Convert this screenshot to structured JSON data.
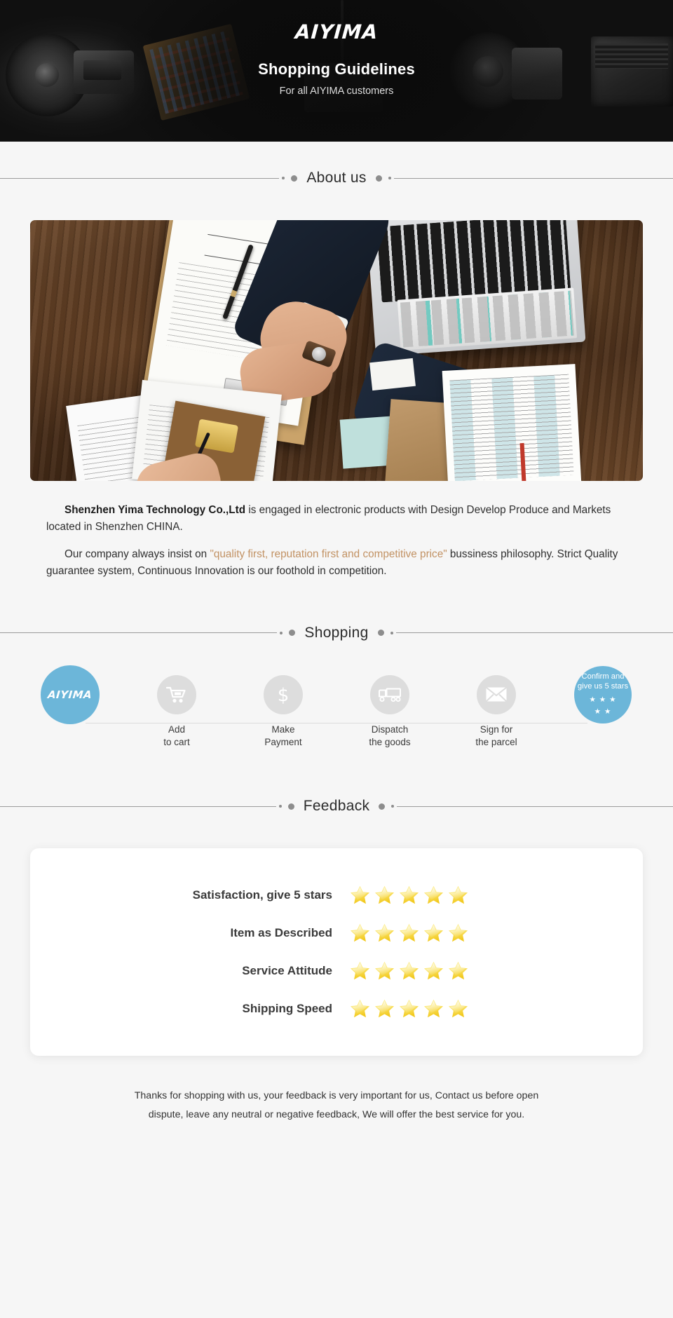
{
  "hero": {
    "brand": "AIYIMA",
    "title": "Shopping Guidelines",
    "subtitle": "For all AIYIMA customers",
    "background_color": "#111111"
  },
  "sections": {
    "about": {
      "divider_label": "About us"
    },
    "shopping": {
      "divider_label": "Shopping"
    },
    "feedback": {
      "divider_label": "Feedback"
    }
  },
  "about": {
    "paragraph1": {
      "strong": "Shenzhen Yima Technology Co.,Ltd",
      "rest": " is engaged in electronic products with Design Develop Produce and Markets located in Shenzhen CHINA."
    },
    "paragraph2": {
      "lead": "Our company always insist on ",
      "quote": "\"quality first, reputation first and competitive price\"",
      "rest": " bussiness philosophy. Strict Quality guarantee system, Continuous Innovation is our foothold in competition."
    },
    "photo_alt": "business-handshake-over-desk-with-contract-laptop-and-documents"
  },
  "shopping": {
    "accent_color": "#6cb6d9",
    "inactive_color": "#dddddd",
    "steps": [
      {
        "id": "brand",
        "icon": "aiyima-logo-icon",
        "logo_text": "AIYIMA",
        "label_line1": "",
        "label_line2": "",
        "active": true
      },
      {
        "id": "add-to-cart",
        "icon": "shopping-cart-icon",
        "label_line1": "Add",
        "label_line2": "to cart",
        "active": false
      },
      {
        "id": "make-payment",
        "icon": "dollar-icon",
        "label_line1": "Make",
        "label_line2": "Payment",
        "active": false
      },
      {
        "id": "dispatch-goods",
        "icon": "truck-icon",
        "label_line1": "Dispatch",
        "label_line2": "the goods",
        "active": false
      },
      {
        "id": "sign-parcel",
        "icon": "envelope-icon",
        "label_line1": "Sign for",
        "label_line2": "the parcel",
        "active": false
      },
      {
        "id": "confirm-rate",
        "icon": "five-stars-icon",
        "text_line1": "Confirm and",
        "text_line2": "give us 5 stars",
        "stars_row1": "★ ★ ★",
        "stars_row2": "★ ★",
        "active": true
      }
    ]
  },
  "feedback": {
    "star_color": "#f6d750",
    "max_stars": 5,
    "rows": [
      {
        "label": "Satisfaction, give 5 stars",
        "stars": 5
      },
      {
        "label": "Item as Described",
        "stars": 5
      },
      {
        "label": "Service Attitude",
        "stars": 5
      },
      {
        "label": "Shipping Speed",
        "stars": 5
      }
    ]
  },
  "footer": {
    "line1": "Thanks for shopping with us, your feedback is very important for us, Contact us before open",
    "line2": "dispute, leave any neutral or negative feedback, We will offer the best service for you."
  }
}
